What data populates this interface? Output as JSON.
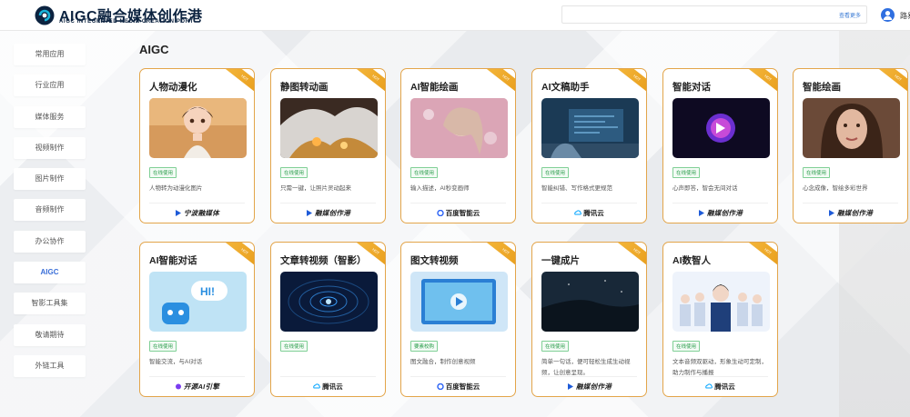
{
  "header": {
    "logo_title": "AIGC融合媒体创作港",
    "logo_subtitle": "AIGC INTEGRATED MEDIA CREATION PORT",
    "search_link": "查看更多",
    "user_name": "路易"
  },
  "sidebar": {
    "items": [
      {
        "label": "常用应用"
      },
      {
        "label": "行业应用"
      },
      {
        "label": "媒体服务"
      },
      {
        "label": "视频制作"
      },
      {
        "label": "图片制作"
      },
      {
        "label": "音频制作"
      },
      {
        "label": "办公协作"
      },
      {
        "label": "AIGC"
      },
      {
        "label": "智影工具集"
      },
      {
        "label": "敬请期待"
      },
      {
        "label": "外链工具"
      }
    ],
    "active_index": 7
  },
  "section_title": "AIGC",
  "ribbon_text": "HOT",
  "cards": [
    {
      "title": "人物动漫化",
      "badge": "在线使用",
      "desc": "人物转为动漫化图片",
      "brand": "宁波融媒体",
      "brand_color": "#1e5bd8"
    },
    {
      "title": "静图转动画",
      "badge": "在线使用",
      "desc": "只需一键，让照片灵动起来",
      "brand": "融媒创作港",
      "brand_color": "#1e5bd8"
    },
    {
      "title": "AI智能绘画",
      "badge": "在线使用",
      "desc": "输入描述，AI秒变画师",
      "brand": "百度智能云",
      "brand_color": "#2a62f5"
    },
    {
      "title": "AI文稿助手",
      "badge": "在线使用",
      "desc": "智能纠错、写作格式更规范",
      "brand": "腾讯云",
      "brand_color": "#00a3ff"
    },
    {
      "title": "智能对话",
      "badge": "在线使用",
      "desc": "心声即答，智会无间对话",
      "brand": "融媒创作港",
      "brand_color": "#1e5bd8"
    },
    {
      "title": "智能绘画",
      "badge": "在线使用",
      "desc": "心念成像，智绘多彩世界",
      "brand": "融媒创作港",
      "brand_color": "#1e5bd8"
    },
    {
      "title": "AI智能对话",
      "badge": "在线使用",
      "desc": "智能交流，与AI对话",
      "brand": "开源AI引擎",
      "brand_color": "#7a3cf0"
    },
    {
      "title": "文章转视频（智影）",
      "badge": "在线使用",
      "desc": "",
      "brand": "腾讯云",
      "brand_color": "#00a3ff"
    },
    {
      "title": "图文转视频",
      "badge": "要素校购",
      "desc": "图文融合，制作创意视频",
      "brand": "百度智能云",
      "brand_color": "#2a62f5"
    },
    {
      "title": "一键成片",
      "badge": "在线使用",
      "desc": "简单一句话，便可轻松生成生动视频，让创意呈现。",
      "brand": "融媒创作港",
      "brand_color": "#1e5bd8"
    },
    {
      "title": "AI数智人",
      "badge": "在线使用",
      "desc": "文本音频双驱动，形象生动可定制，助力制作与播报",
      "brand": "腾讯云",
      "brand_color": "#00a3ff"
    }
  ],
  "colors": {
    "accent": "#e3a54a",
    "badge_green": "#2a9d4b",
    "active_blue": "#3a6fd8"
  }
}
